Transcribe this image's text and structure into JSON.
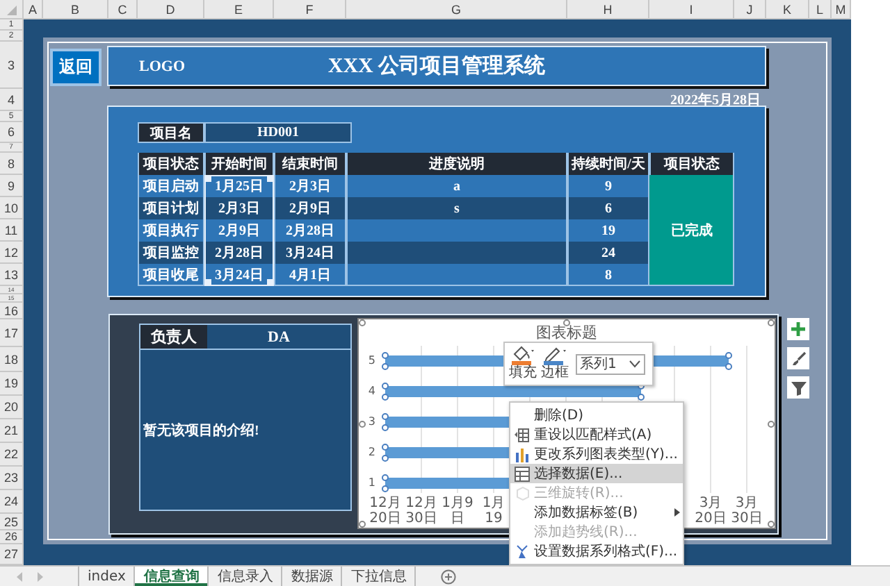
{
  "column_headers": [
    "A",
    "B",
    "C",
    "D",
    "E",
    "F",
    "G",
    "H",
    "I",
    "J",
    "K",
    "L",
    "M"
  ],
  "row_headers": [
    "1",
    "2",
    "3",
    "4",
    "5",
    "6",
    "7",
    "8",
    "9",
    "10",
    "11",
    "12",
    "13",
    "14",
    "15",
    "16",
    "17",
    "18",
    "19",
    "20",
    "21",
    "22",
    "23",
    "24",
    "25",
    "26",
    "27"
  ],
  "back_button": "返回",
  "header": {
    "logo": "LOGO",
    "title": "XXX 公司项目管理系统"
  },
  "date": "2022年5月28日",
  "project": {
    "label": "项目名",
    "value": "HD001"
  },
  "table": {
    "columns": [
      {
        "label": "项目状态",
        "selected": false
      },
      {
        "label": "开始时间",
        "selected": true
      },
      {
        "label": "结束时间",
        "selected": false
      },
      {
        "label": "进度说明",
        "selected": false
      },
      {
        "label": "持续时间/天",
        "selected": false
      },
      {
        "label": "项目状态",
        "selected": false
      }
    ],
    "rows": [
      {
        "phase": "项目启动",
        "start": "1月25日",
        "end": "2月3日",
        "note": "a",
        "days": "9"
      },
      {
        "phase": "项目计划",
        "start": "2月3日",
        "end": "2月9日",
        "note": "s",
        "days": "6"
      },
      {
        "phase": "项目执行",
        "start": "2月9日",
        "end": "2月28日",
        "days": "19"
      },
      {
        "phase": "项目监控",
        "start": "2月28日",
        "end": "3月24日",
        "days": "24"
      },
      {
        "phase": "项目收尾",
        "start": "3月24日",
        "end": "4月1日",
        "days": "8"
      }
    ],
    "status": "已完成"
  },
  "owner": {
    "label": "负责人",
    "value": "DA",
    "intro": "暂无该项目的介绍!"
  },
  "chart": {
    "title": "图表标题",
    "selected": true,
    "y_labels": [
      "5",
      "4",
      "3",
      "2",
      "1"
    ],
    "x_labels": [
      "12月20日",
      "12月30日",
      "1月9日",
      "1月19",
      "3月20日",
      "3月30日"
    ]
  },
  "format_toolbar": {
    "fill_label": "填充",
    "border_label": "边框",
    "series": "系列1"
  },
  "context_menu": [
    {
      "label": "删除(D)",
      "disabled": false,
      "selected": false,
      "has_submenu": false
    },
    {
      "label": "重设以匹配样式(A)",
      "disabled": false,
      "selected": false,
      "has_submenu": false
    },
    {
      "label": "更改系列图表类型(Y)...",
      "disabled": false,
      "selected": false,
      "has_submenu": false
    },
    {
      "label": "选择数据(E)...",
      "disabled": false,
      "selected": true,
      "has_submenu": false
    },
    {
      "label": "三维旋转(R)...",
      "disabled": true,
      "selected": false,
      "has_submenu": false
    },
    {
      "label": "添加数据标签(B)",
      "disabled": false,
      "selected": false,
      "has_submenu": true
    },
    {
      "label": "添加趋势线(R)...",
      "disabled": true,
      "selected": false,
      "has_submenu": false
    },
    {
      "label": "设置数据系列格式(F)...",
      "disabled": false,
      "selected": false,
      "has_submenu": false
    }
  ],
  "sheet_tabs": [
    {
      "label": "index",
      "selected": false
    },
    {
      "label": "信息查询",
      "selected": true
    },
    {
      "label": "信息录入",
      "selected": false
    },
    {
      "label": "数据源",
      "selected": false
    },
    {
      "label": "下拉信息",
      "selected": false
    }
  ]
}
